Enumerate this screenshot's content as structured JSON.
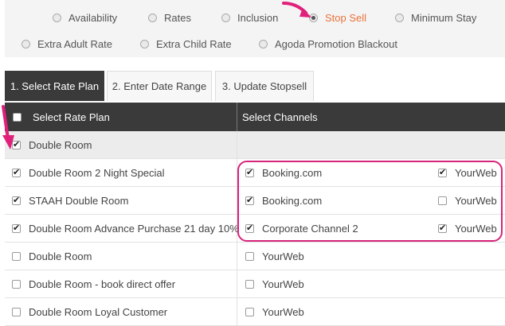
{
  "options": [
    {
      "label": "Availability",
      "selected": false
    },
    {
      "label": "Rates",
      "selected": false
    },
    {
      "label": "Inclusion",
      "selected": false
    },
    {
      "label": "Stop Sell",
      "selected": true
    },
    {
      "label": "Minimum Stay",
      "selected": false
    },
    {
      "label": "Extra Adult Rate",
      "selected": false
    },
    {
      "label": "Extra Child Rate",
      "selected": false
    },
    {
      "label": "Agoda Promotion Blackout",
      "selected": false
    }
  ],
  "tabs": [
    {
      "label": "1. Select Rate Plan",
      "active": true
    },
    {
      "label": "2. Enter Date Range",
      "active": false
    },
    {
      "label": "3. Update Stopsell",
      "active": false
    }
  ],
  "grid": {
    "header_rate_plan": "Select Rate Plan",
    "header_channels": "Select Channels",
    "rows": [
      {
        "name": "Double Room",
        "checked": true,
        "group": true,
        "channels": []
      },
      {
        "name": "Double Room 2 Night Special",
        "checked": true,
        "channels": [
          {
            "label": "Booking.com",
            "checked": true
          },
          {
            "label": "YourWeb",
            "checked": true
          }
        ]
      },
      {
        "name": "STAAH Double Room",
        "checked": true,
        "channels": [
          {
            "label": "Booking.com",
            "checked": true
          },
          {
            "label": "YourWeb",
            "checked": false
          }
        ]
      },
      {
        "name": "Double Room Advance Purchase 21 day 10%",
        "checked": true,
        "channels": [
          {
            "label": "Corporate Channel 2",
            "checked": true
          },
          {
            "label": "YourWeb",
            "checked": true
          }
        ]
      },
      {
        "name": "Double Room",
        "checked": false,
        "channels": [
          {
            "label": "YourWeb",
            "checked": false
          }
        ]
      },
      {
        "name": "Double Room - book direct offer",
        "checked": false,
        "channels": [
          {
            "label": "YourWeb",
            "checked": false
          }
        ]
      },
      {
        "name": "Double Room Loyal Customer",
        "checked": false,
        "channels": [
          {
            "label": "YourWeb",
            "checked": false
          }
        ]
      }
    ]
  },
  "colors": {
    "accent": "#e8743b",
    "highlight": "#d6247a",
    "header_bg": "#3a3a3a"
  }
}
